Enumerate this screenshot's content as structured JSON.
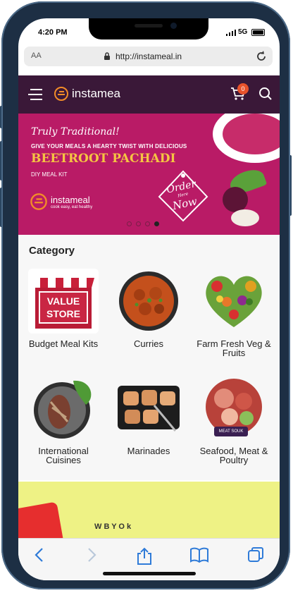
{
  "status": {
    "time": "4:20 PM",
    "network": "5G"
  },
  "browser": {
    "text_size": "AA",
    "url": "http://instameal.in"
  },
  "header": {
    "brand_prefix": "insta",
    "brand_suffix": "mea",
    "cart_count": "0"
  },
  "banner": {
    "tagline": "Truly Traditional!",
    "headline": "GIVE YOUR MEALS A HEARTY TWIST WITH DELICIOUS",
    "title": "BEETROOT PACHADI",
    "subtitle": "DIY MEAL KIT",
    "logo_text": "instameal",
    "logo_caption": "cook easy, eat healthy",
    "order_line1": "Order",
    "order_line2": "Now",
    "order_mid": "Here",
    "active_slide": 4,
    "slide_count": 4
  },
  "category": {
    "title": "Category",
    "items": [
      {
        "label": "Budget Meal Kits",
        "icon": "value-store-icon"
      },
      {
        "label": "Curries",
        "icon": "curry-bowl-icon"
      },
      {
        "label": "Farm Fresh Veg & Fruits",
        "icon": "veg-heart-icon"
      },
      {
        "label": "International Cuisines",
        "icon": "plate-icon"
      },
      {
        "label": "Marinades",
        "icon": "marinade-tray-icon"
      },
      {
        "label": "Seafood, Meat & Poultry",
        "icon": "meat-platter-icon"
      }
    ],
    "store_sign_line1": "VALUE",
    "store_sign_line2": "STORE",
    "meat_souk_label": "MEAT SOUK"
  },
  "promo": {
    "peek_text": "W  B   Y  O  k"
  },
  "colors": {
    "header": "#3a1838",
    "banner": "#b91b66",
    "accent": "#e8522b",
    "promo": "#eef285"
  }
}
